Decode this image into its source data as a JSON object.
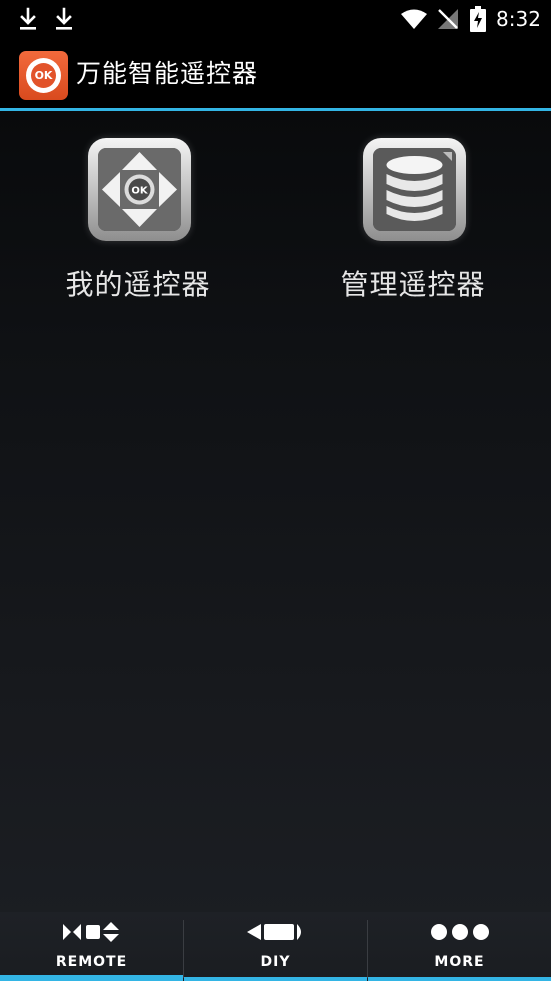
{
  "status_bar": {
    "time": "8:32",
    "icons": [
      "download-icon",
      "download-icon",
      "wifi-icon",
      "no-signal-icon",
      "battery-charging-icon"
    ]
  },
  "app_bar": {
    "logo_text": "OK",
    "title": "万能智能遥控器"
  },
  "grid": {
    "items": [
      {
        "label": "我的遥控器",
        "icon": "dpad-remote-icon"
      },
      {
        "label": "管理遥控器",
        "icon": "database-icon"
      }
    ]
  },
  "tabs": {
    "items": [
      {
        "label": "REMOTE",
        "icon": "remote-controls-icon",
        "active": true
      },
      {
        "label": "DIY",
        "icon": "pen-icon",
        "active": false
      },
      {
        "label": "MORE",
        "icon": "more-dots-icon",
        "active": false
      }
    ]
  },
  "colors": {
    "accent": "#33b5e5",
    "logo": "#e2532a",
    "background": "#0f1114"
  }
}
